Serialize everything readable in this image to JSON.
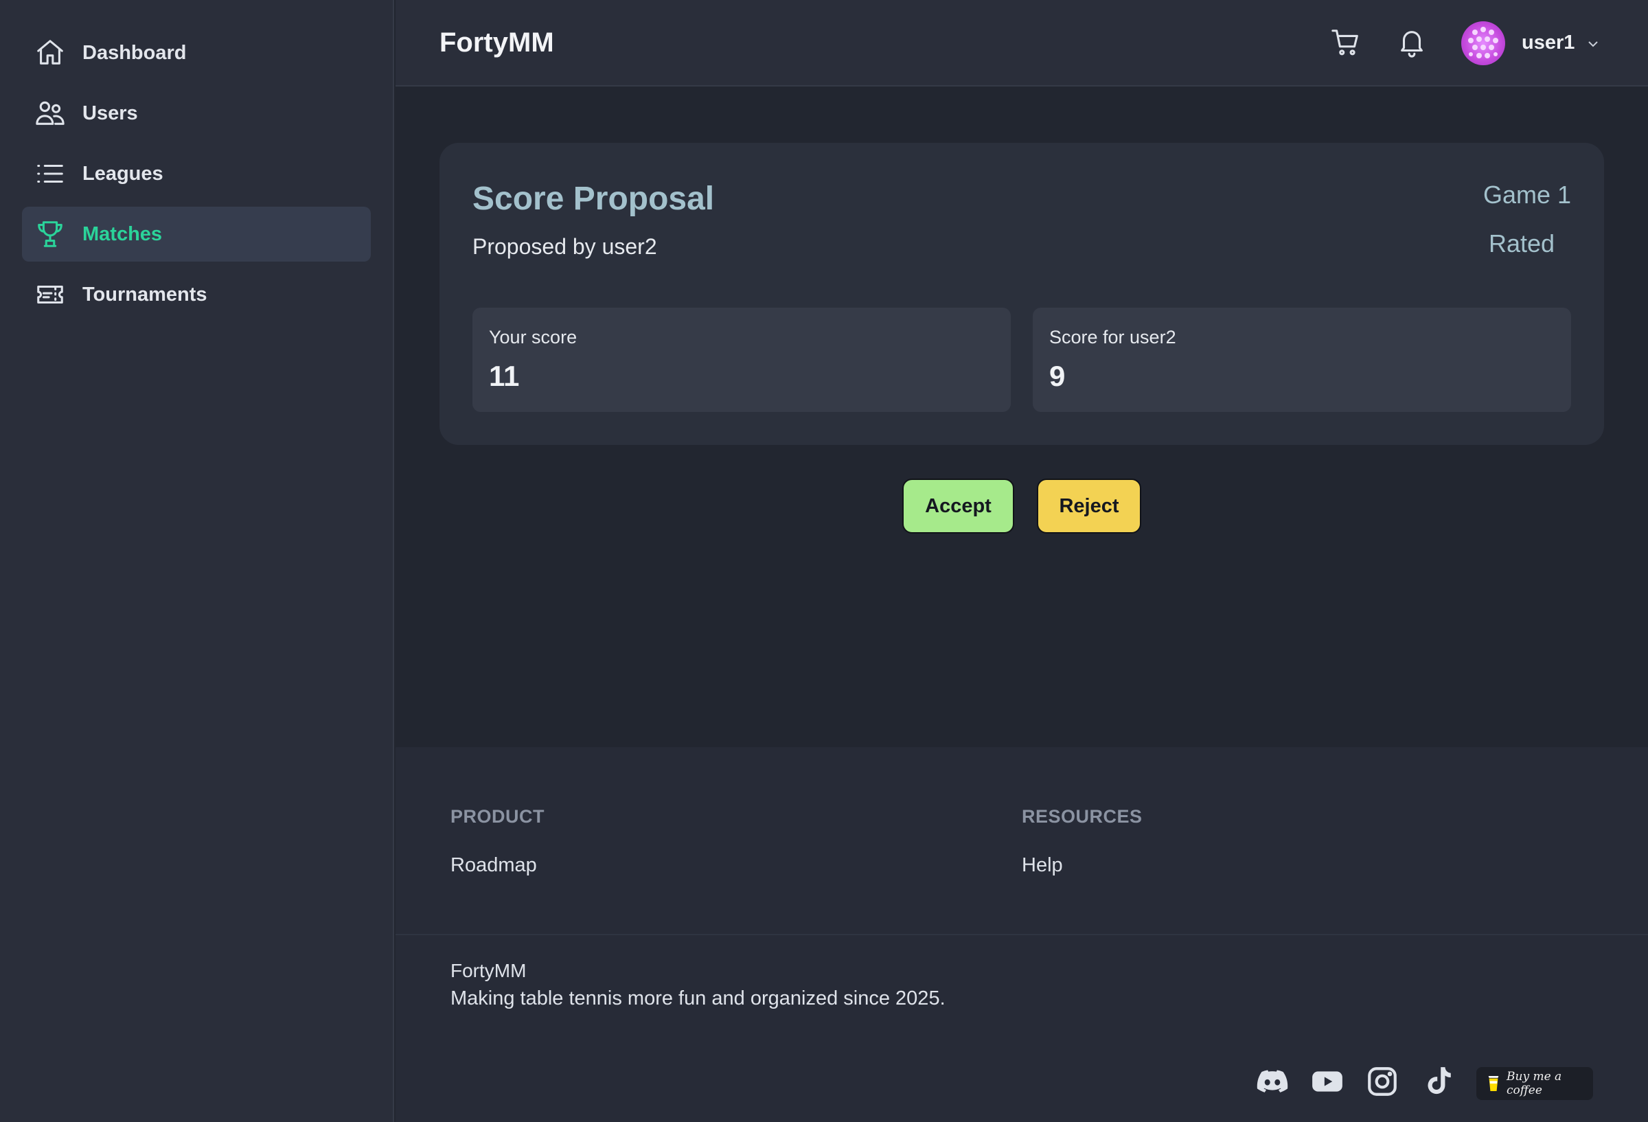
{
  "app": {
    "brand": "FortyMM"
  },
  "sidebar": {
    "items": [
      {
        "label": "Dashboard",
        "icon": "home-icon",
        "active": false
      },
      {
        "label": "Users",
        "icon": "users-icon",
        "active": false
      },
      {
        "label": "Leagues",
        "icon": "list-icon",
        "active": false
      },
      {
        "label": "Matches",
        "icon": "trophy-icon",
        "active": true
      },
      {
        "label": "Tournaments",
        "icon": "ticket-icon",
        "active": false
      }
    ]
  },
  "header": {
    "brand": "FortyMM",
    "icons": [
      "cart-icon",
      "bell-icon"
    ],
    "user": {
      "name": "user1",
      "avatar": "avatar-icon"
    }
  },
  "proposal": {
    "title": "Score Proposal",
    "proposed_by": "Proposed by user2",
    "game": "Game 1",
    "rated": "Rated",
    "your_score_label": "Your score",
    "your_score": "11",
    "opponent_score_label": "Score for user2",
    "opponent_score": "9"
  },
  "actions": {
    "accept": "Accept",
    "reject": "Reject"
  },
  "footer": {
    "product_heading": "PRODUCT",
    "product_links": [
      "Roadmap"
    ],
    "resources_heading": "RESOURCES",
    "resources_links": [
      "Help"
    ],
    "brand": "FortyMM",
    "tagline": "Making table tennis more fun and organized since 2025.",
    "social": [
      "discord-icon",
      "youtube-icon",
      "instagram-icon",
      "tiktok-icon"
    ],
    "coffee": "Buy me a coffee"
  },
  "colors": {
    "accent": "#2bd39a",
    "accept": "#a6ea8b",
    "reject": "#f3d253",
    "title": "#a3c1cc",
    "background": "#222630",
    "panel": "#2a2e3a"
  }
}
